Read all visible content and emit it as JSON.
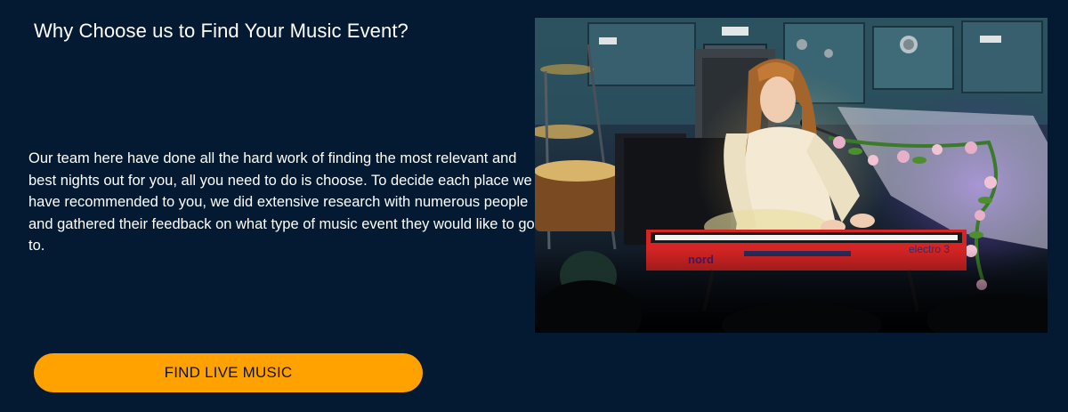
{
  "section": {
    "heading": "Why Choose us to Find Your Music Event?",
    "body": "Our team here have done all the hard work of finding the most relevant and best nights out for you, all you need to do is choose. To decide each place we have recommended to you, we did extensive research with numerous people and gathered their feedback on what type of music event they would like to go to."
  },
  "cta": {
    "label": "FIND LIVE MUSIC"
  },
  "photo": {
    "keyboard_brand": "nord",
    "keyboard_model": "electro 3"
  },
  "colors": {
    "background": "#041a33",
    "button": "#ffa200",
    "button_text": "#121212",
    "text": "#ffffff",
    "keyboard": "#d42424"
  }
}
